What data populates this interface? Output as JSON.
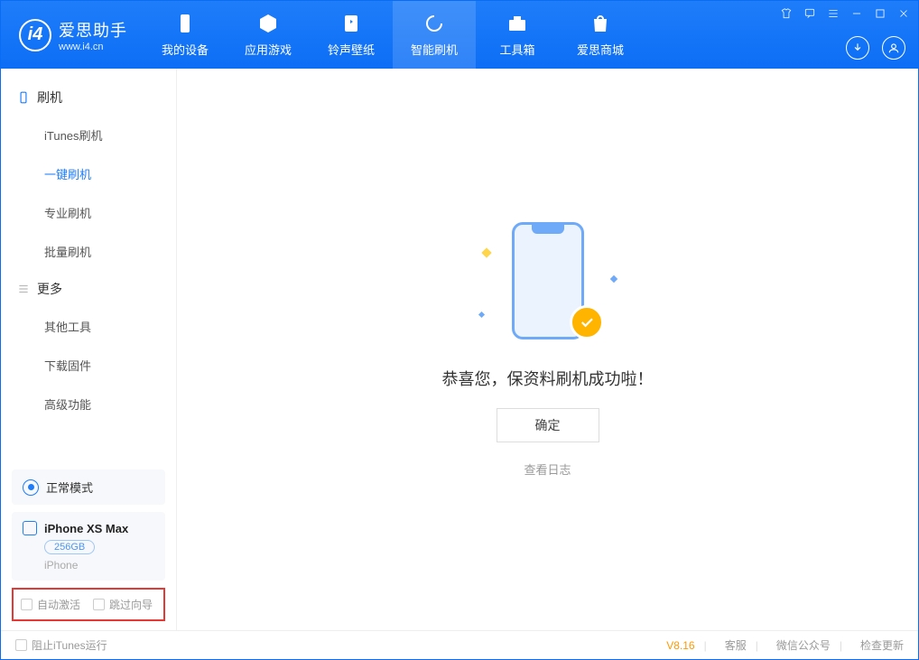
{
  "app": {
    "title": "爱思助手",
    "subtitle": "www.i4.cn"
  },
  "nav": {
    "device": "我的设备",
    "apps": "应用游戏",
    "ringtone": "铃声壁纸",
    "flash": "智能刷机",
    "toolbox": "工具箱",
    "store": "爱思商城"
  },
  "sidebar": {
    "group_flash": "刷机",
    "itunes_flash": "iTunes刷机",
    "one_click": "一键刷机",
    "pro_flash": "专业刷机",
    "batch_flash": "批量刷机",
    "group_more": "更多",
    "other_tools": "其他工具",
    "download_fw": "下载固件",
    "advanced": "高级功能"
  },
  "mode": {
    "label": "正常模式"
  },
  "device": {
    "name": "iPhone XS Max",
    "capacity": "256GB",
    "type": "iPhone"
  },
  "options": {
    "auto_activate": "自动激活",
    "skip_guide": "跳过向导"
  },
  "main": {
    "success_msg": "恭喜您，保资料刷机成功啦！",
    "ok": "确定",
    "view_log": "查看日志"
  },
  "footer": {
    "block_itunes": "阻止iTunes运行",
    "version": "V8.16",
    "support": "客服",
    "wechat": "微信公众号",
    "update": "检查更新"
  }
}
